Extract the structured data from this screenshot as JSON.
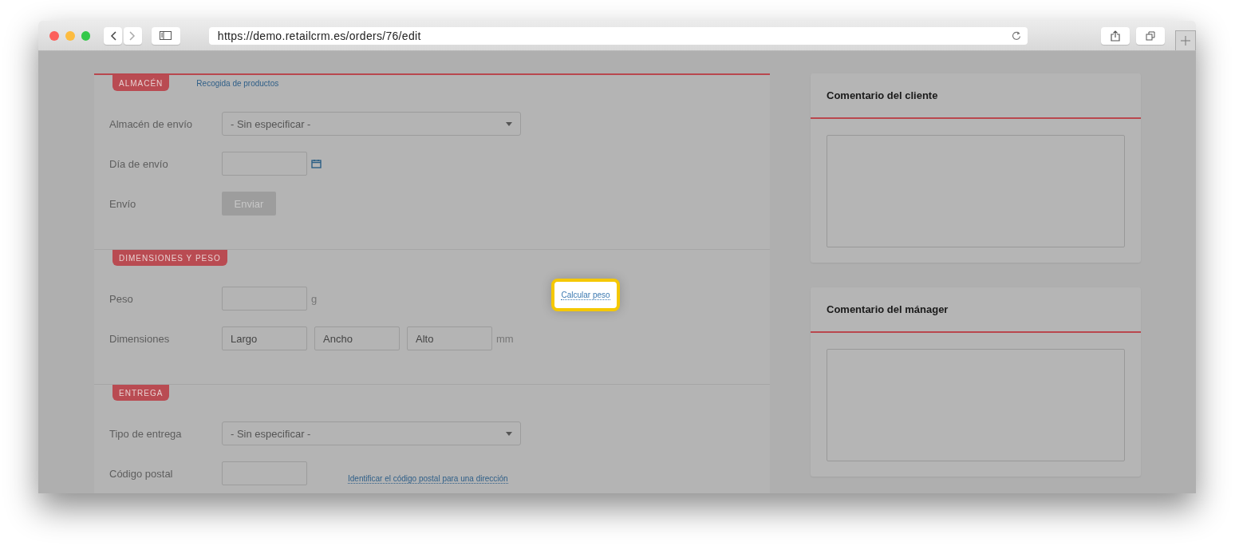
{
  "browser": {
    "url": "https://demo.retailcrm.es/orders/76/edit"
  },
  "sections": [
    {
      "tag": "ALMACÉN",
      "link": "Recogida de productos",
      "rows": [
        {
          "kind": "select",
          "label": "Almacén de envío",
          "value": "- Sin especificar -"
        },
        {
          "kind": "date",
          "label": "Día de envío"
        },
        {
          "kind": "button",
          "label": "Envío",
          "button": "Enviar",
          "disabled": true
        }
      ]
    },
    {
      "tag": "DIMENSIONES Y PESO",
      "rows": [
        {
          "kind": "unit",
          "label": "Peso",
          "unit": "g"
        },
        {
          "kind": "dimensions",
          "label": "Dimensiones",
          "fields": [
            "Largo",
            "Ancho",
            "Alto"
          ],
          "unit": "mm"
        }
      ]
    },
    {
      "tag": "ENTREGA",
      "rows": [
        {
          "kind": "select",
          "label": "Tipo de entrega",
          "value": "- Sin especificar -"
        },
        {
          "kind": "postal",
          "label": "Código postal",
          "link": "Identificar el código postal para una dirección"
        }
      ]
    }
  ],
  "highlight": {
    "link": "Calcular peso"
  },
  "cards": [
    {
      "title": "Comentario del cliente"
    },
    {
      "title": "Comentario del mánager"
    }
  ]
}
